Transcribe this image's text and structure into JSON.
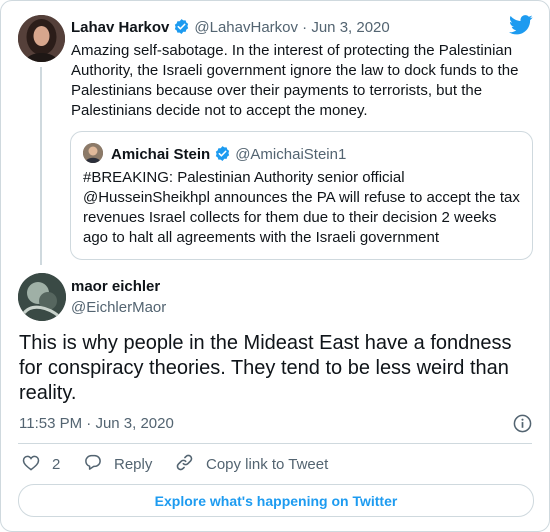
{
  "parent_tweet": {
    "name": "Lahav Harkov",
    "handle": "@LahavHarkov",
    "separator": "·",
    "date": "Jun 3, 2020",
    "text": "Amazing self-sabotage. In the interest of protecting the Palestinian Authority, the Israeli government ignore the law to dock funds to the Palestinians because over their payments to terrorists, but the Palestinians decide not to accept the money."
  },
  "quoted_tweet": {
    "name": "Amichai Stein",
    "handle": "@AmichaiStein1",
    "text": "#BREAKING: Palestinian Authority senior official @HusseinSheikhpl announces the PA will refuse to accept the tax revenues Israel collects for them due to their decision 2 weeks ago to halt all agreements with the Israeli government"
  },
  "reply_tweet": {
    "name": "maor eichler",
    "handle": "@EichlerMaor",
    "text": "This is why people in the Mideast East have a fondness for conspiracy theories. They tend to be less weird than reality.",
    "time": "11:53 PM",
    "separator": "·",
    "date": "Jun 3, 2020"
  },
  "actions": {
    "like_count": "2",
    "reply_label": "Reply",
    "copy_label": "Copy link to Tweet"
  },
  "explore_label": "Explore what's happening on Twitter",
  "colors": {
    "accent": "#1d9bf0",
    "muted_text": "#536471",
    "border": "#cfd9de",
    "main_text": "#0f1419"
  },
  "icons": [
    "twitter-logo-icon",
    "verified-badge-icon",
    "info-icon",
    "heart-icon",
    "reply-bubble-icon",
    "link-icon"
  ]
}
